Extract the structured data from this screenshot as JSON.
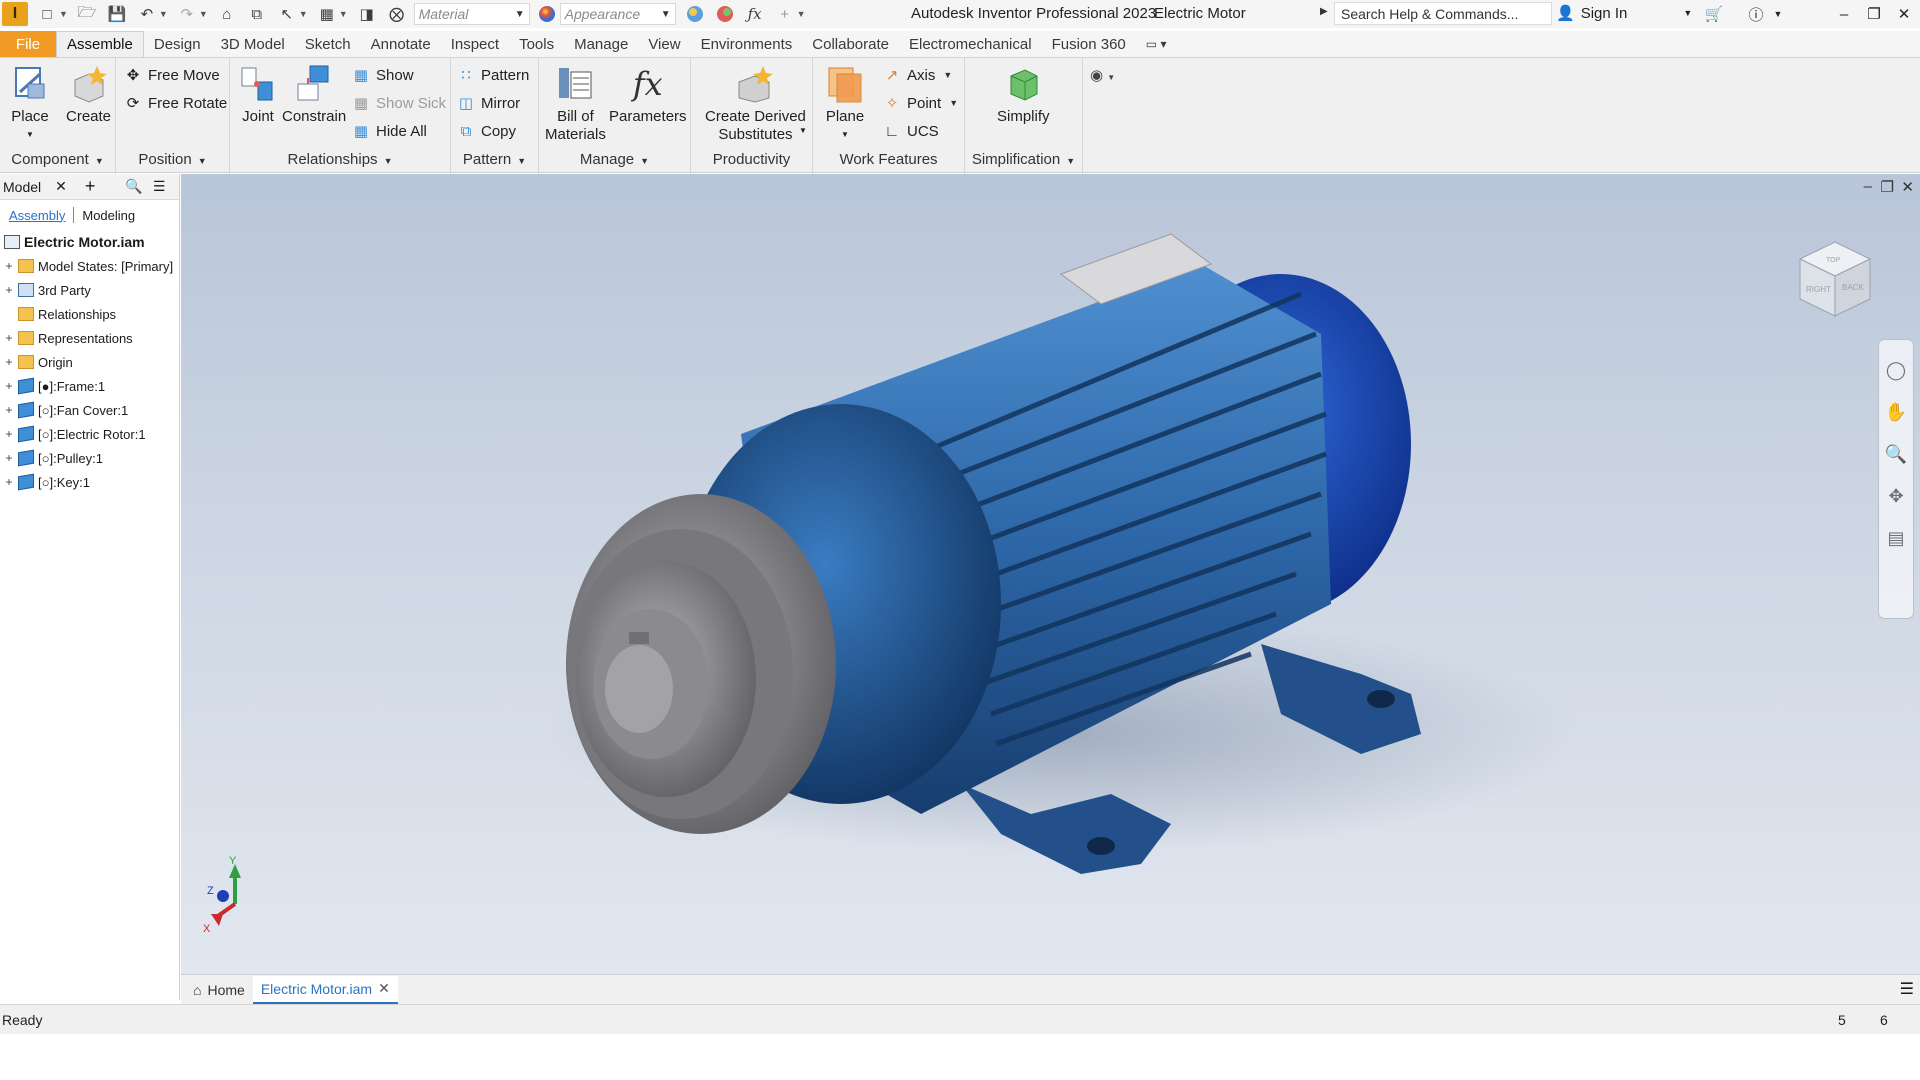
{
  "window": {
    "app_title": "Autodesk Inventor Professional 2023",
    "document_title": "Electric Motor",
    "search_placeholder": "Search Help & Commands...",
    "sign_in": "Sign In",
    "quick_access": {
      "material": "Material",
      "appearance": "Appearance"
    },
    "app_logo": "I"
  },
  "tabs": [
    "File",
    "Assemble",
    "Design",
    "3D Model",
    "Sketch",
    "Annotate",
    "Inspect",
    "Tools",
    "Manage",
    "View",
    "Environments",
    "Collaborate",
    "Electromechanical",
    "Fusion 360"
  ],
  "active_tab": "Assemble",
  "ribbon": {
    "component": {
      "label": "Component",
      "place": "Place",
      "create": "Create"
    },
    "position": {
      "label": "Position",
      "free_move": "Free Move",
      "free_rotate": "Free Rotate"
    },
    "relationships": {
      "label": "Relationships",
      "joint": "Joint",
      "constrain": "Constrain",
      "show": "Show",
      "show_sick": "Show Sick",
      "hide_all": "Hide All"
    },
    "pattern": {
      "label": "Pattern",
      "pattern": "Pattern",
      "mirror": "Mirror",
      "copy": "Copy"
    },
    "manage": {
      "label": "Manage",
      "bom_line1": "Bill of",
      "bom_line2": "Materials",
      "parameters": "Parameters",
      "fx": "fx"
    },
    "productivity": {
      "label": "Productivity",
      "create_derived_line1": "Create Derived",
      "create_derived_line2": "Substitutes"
    },
    "work_features": {
      "label": "Work Features",
      "plane": "Plane",
      "axis": "Axis",
      "point": "Point",
      "ucs": "UCS"
    },
    "simplification": {
      "label": "Simplification",
      "simplify": "Simplify"
    }
  },
  "browser": {
    "title": "Model",
    "tab_assembly": "Assembly",
    "tab_modeling": "Modeling",
    "root": "Electric Motor.iam",
    "items": [
      {
        "label": "Model States: [Primary]",
        "icon": "folder",
        "expandable": true
      },
      {
        "label": "3rd Party",
        "icon": "folder-blue",
        "expandable": true
      },
      {
        "label": "Relationships",
        "icon": "folder",
        "expandable": false
      },
      {
        "label": "Representations",
        "icon": "folder",
        "expandable": true
      },
      {
        "label": "Origin",
        "icon": "folder",
        "expandable": true
      },
      {
        "label": "[●]:Frame:1",
        "icon": "part",
        "expandable": true
      },
      {
        "label": "[○]:Fan Cover:1",
        "icon": "part",
        "expandable": true
      },
      {
        "label": "[○]:Electric Rotor:1",
        "icon": "part",
        "expandable": true
      },
      {
        "label": "[○]:Pulley:1",
        "icon": "part",
        "expandable": true
      },
      {
        "label": "[○]:Key:1",
        "icon": "part",
        "expandable": true
      }
    ]
  },
  "viewcube": {
    "face_top": "TOP",
    "face_right": "RIGHT",
    "face_back": "BACK"
  },
  "triad": {
    "x": "X",
    "y": "Y",
    "z": "Z"
  },
  "document_tabs": {
    "home": "Home",
    "active": "Electric Motor.iam"
  },
  "status": {
    "text": "Ready",
    "num1": "5",
    "num2": "6"
  },
  "colors": {
    "accent": "#f19a24",
    "motor_blue": "#2f6db0",
    "link_blue": "#2a73c2"
  }
}
